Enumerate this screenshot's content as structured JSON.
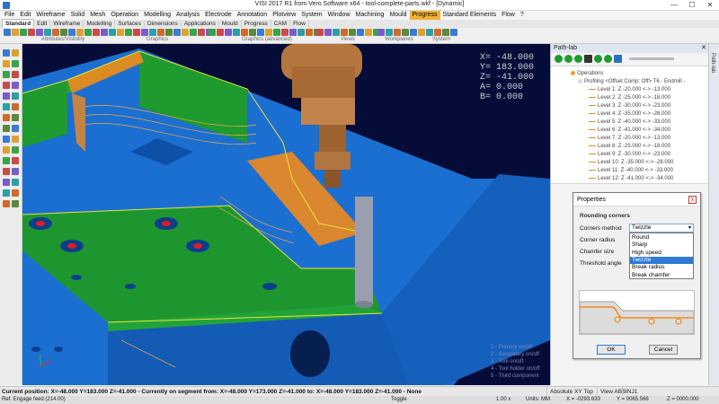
{
  "window": {
    "title": "VISI 2017 R1   from Vero Software x64 - tool-complete-parts.wkf - [Dynamic]",
    "minimize": "—",
    "maximize": "☐",
    "close": "✕"
  },
  "menus": [
    "File",
    "Edit",
    "Wireframe",
    "Solid",
    "Mesh",
    "Operation",
    "Modelling",
    "Analysis",
    "Electrode",
    "Annotation",
    "Plotview",
    "System",
    "Window",
    "Machining",
    "Mould",
    "Progress",
    "Standard Elements",
    "Flow",
    "?"
  ],
  "active_menu": "Progress",
  "tabs": [
    "Standard",
    "Edit",
    "Wireframe",
    "Modelling",
    "Surfaces",
    "Dimensions",
    "Applications",
    "Mould",
    "Progress",
    "CAM",
    "Flow"
  ],
  "active_tab": "Standard",
  "toolbar_groups": [
    "Attributes/Visibility",
    "Graphics",
    "Graphics (advanced)",
    "Views",
    "Workplanes",
    "System"
  ],
  "coordinates": [
    {
      "axis": "X=",
      "value": "-48.000"
    },
    {
      "axis": "Y=",
      "value": "183.000"
    },
    {
      "axis": "Z=",
      "value": "-41.000"
    },
    {
      "axis": "A=",
      "value": "0.000"
    },
    {
      "axis": "B=",
      "value": "0.000"
    }
  ],
  "view_legend": [
    "1 - Primary on/off",
    "2 - Secondary on/off",
    "3 - Tool on/off",
    "4 - Tool holder on/off",
    "5 - Third component"
  ],
  "pathlab": {
    "title": "Path-lab",
    "close": "✕",
    "side_tab": "Path-lab",
    "tree_root": "Operations",
    "operation": "Profiling <Offset Comp: Off> T6 - Endmill -",
    "levels": [
      "Level 1: Z -20.000 <-> -13.000",
      "Level 2: Z -25.000 <-> -18.000",
      "Level 3: Z -30.000 <-> -23.000",
      "Level 4: Z -35.000 <-> -28.000",
      "Level 5: Z -40.000 <-> -33.000",
      "Level 6: Z -41.000 <-> -34.000",
      "Level 7: Z -20.000 <-> -13.000",
      "Level 8: Z -25.000 <-> -18.000",
      "Level 9: Z -30.000 <-> -23.000",
      "Level 10: Z -35.000 <-> -28.000",
      "Level 11: Z -40.000 <-> -33.000",
      "Level 12: Z -41.000 <-> -34.000"
    ]
  },
  "properties": {
    "title": "Properties",
    "close": "x",
    "section": "Rounding corners",
    "labels": {
      "corners_method": "Corners method",
      "corner_radius": "Corner radius",
      "chamfer_size": "Chamfer size",
      "threshold_angle": "Threshold angle"
    },
    "corners_method_value": "Twizzle",
    "options": [
      "Round",
      "Sharp",
      "High speed",
      "Twizzle",
      "Break radius",
      "Break chamfer"
    ],
    "selected_option": "Twizzle",
    "ok": "OK",
    "cancel": "Cancel"
  },
  "status": {
    "current_position": "Current position: X=-48.000 Y=183.000 Z=-41.000 - Currently on segment from: X=-48.000 Y=173.000 Z=-41.000 to: X=-48.000 Y=183.000 Z=-41.000 - None",
    "absolute": "Absolute XY Top",
    "view": "View ABS",
    "inj": "INJ1",
    "feed": "Ref. Engage feed (214.00)",
    "toggle": "Toggle",
    "zoom": "1.00 x",
    "units": "Units: MM",
    "coords_x": "X = -0293.633",
    "coords_y": "Y = 0065.566",
    "coords_z": "Z = 0000.000"
  },
  "colors": {
    "accent": "#f2b233",
    "viewport_bg": "#060c38",
    "part_blue": "#1a6fd0",
    "part_green": "#1f9a2e",
    "toolpath_orange": "#f08a1e",
    "tool_bronze": "#b5763d",
    "selection_blue": "#2f7ad8"
  }
}
